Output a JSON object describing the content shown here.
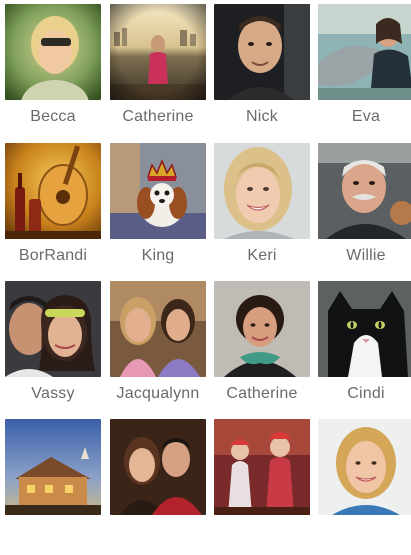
{
  "friends": [
    {
      "name": "Becca",
      "photo": "photo-woman-sunglasses-green"
    },
    {
      "name": "Catherine",
      "photo": "photo-woman-city-skyline"
    },
    {
      "name": "Nick",
      "photo": "photo-man-portrait"
    },
    {
      "name": "Eva",
      "photo": "photo-woman-with-dolphin"
    },
    {
      "name": "BorRandi",
      "photo": "photo-guitar-and-bottles"
    },
    {
      "name": "King",
      "photo": "photo-dog-with-crown"
    },
    {
      "name": "Keri",
      "photo": "photo-smiling-blonde-woman"
    },
    {
      "name": "Willie",
      "photo": "photo-man-with-mustache"
    },
    {
      "name": "Vassy",
      "photo": "photo-couple-headband"
    },
    {
      "name": "Jacqualynn",
      "photo": "photo-two-women"
    },
    {
      "name": "Catherine",
      "photo": "photo-woman-green-scarf"
    },
    {
      "name": "Cindi",
      "photo": "photo-black-white-cat"
    },
    {
      "name": "",
      "photo": "photo-house-at-dusk"
    },
    {
      "name": "",
      "photo": "photo-couple-red-shirt"
    },
    {
      "name": "",
      "photo": "photo-costumed-children"
    },
    {
      "name": "",
      "photo": "photo-smiling-woman-blue"
    }
  ]
}
